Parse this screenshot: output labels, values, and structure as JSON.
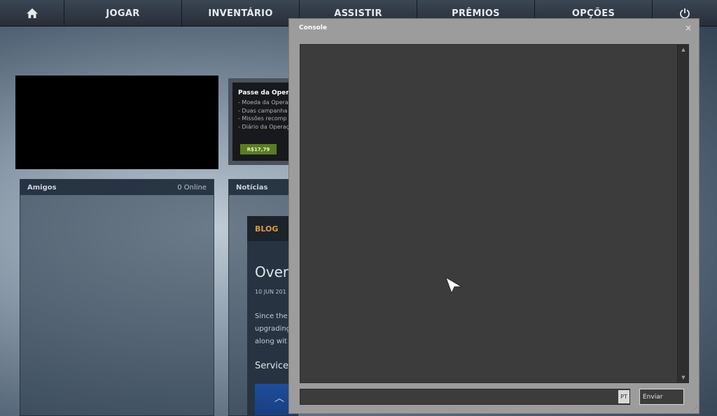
{
  "nav": {
    "home_icon": "home-icon",
    "items": [
      "JOGAR",
      "INVENTÁRIO",
      "ASSISTIR",
      "PRÊMIOS",
      "OPÇÕES"
    ],
    "power_icon": "power-icon"
  },
  "promo": {
    "title": "Passe da Operaç",
    "lines": [
      "- Moeda da Opera",
      "- Duas campanha",
      "- Missões recomp",
      "- Diário da Operaç"
    ],
    "price": "R$17,79"
  },
  "friends": {
    "title": "Amigos",
    "online_count": "0 Online"
  },
  "news": {
    "title": "Notícias",
    "blog_label": "BLOG",
    "headline": "Over",
    "date": "10 JUN 201",
    "body_lines": [
      "Since the",
      "upgrading",
      "along wit"
    ],
    "subheading": "Service"
  },
  "console": {
    "title": "Console",
    "close_glyph": "×",
    "input_value": "",
    "lang_badge": "PT",
    "send_label": "Enviar"
  },
  "colors": {
    "nav_bg": "#2e3742",
    "console_frame": "#9c9c9c",
    "console_area": "#3c3c3c",
    "price_green": "#5b7c22",
    "blog_orange": "#e09a3a"
  }
}
